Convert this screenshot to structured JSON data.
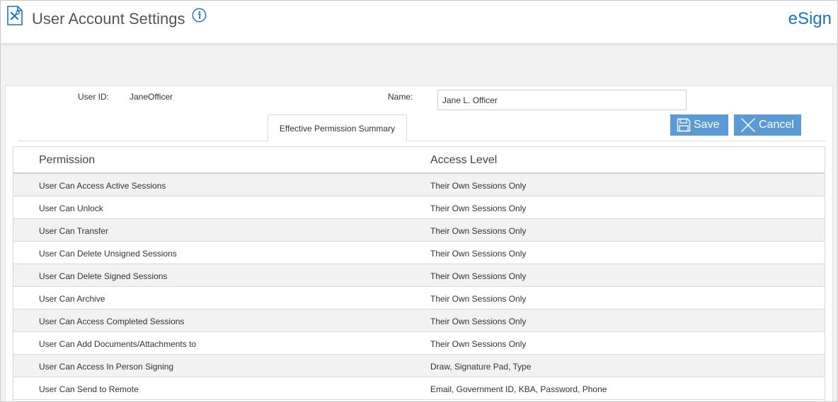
{
  "header": {
    "title": "User Account Settings",
    "brand": "eSign",
    "icons": {
      "document": "document-tools-icon",
      "info": "info-icon"
    },
    "colors": {
      "brand": "#1b75bc",
      "button": "#5b9bd5"
    }
  },
  "user": {
    "id_label": "User ID:",
    "id_value": "JaneOfficer",
    "name_label": "Name:",
    "name_value": "Jane L. Officer"
  },
  "tabs": [
    {
      "label": "Effective Permission Summary"
    }
  ],
  "toolbar": {
    "save_label": "Save",
    "cancel_label": "Cancel"
  },
  "table": {
    "headers": [
      "Permission",
      "Access Level"
    ],
    "rows": [
      {
        "permission": "User Can Access Active Sessions",
        "access": "Their Own Sessions Only"
      },
      {
        "permission": "User Can Unlock",
        "access": "Their Own Sessions Only"
      },
      {
        "permission": "User Can Transfer",
        "access": "Their Own Sessions Only"
      },
      {
        "permission": "User Can Delete Unsigned Sessions",
        "access": "Their Own Sessions Only"
      },
      {
        "permission": "User Can Delete Signed Sessions",
        "access": "Their Own Sessions Only"
      },
      {
        "permission": "User Can Archive",
        "access": "Their Own Sessions Only"
      },
      {
        "permission": "User Can Access Completed Sessions",
        "access": "Their Own Sessions Only"
      },
      {
        "permission": "User Can Add Documents/Attachments to",
        "access": "Their Own Sessions Only"
      },
      {
        "permission": "User Can Access In Person Signing",
        "access": "Draw, Signature Pad, Type"
      },
      {
        "permission": "User Can Send to Remote",
        "access": "Email, Government ID, KBA, Password, Phone"
      }
    ]
  }
}
